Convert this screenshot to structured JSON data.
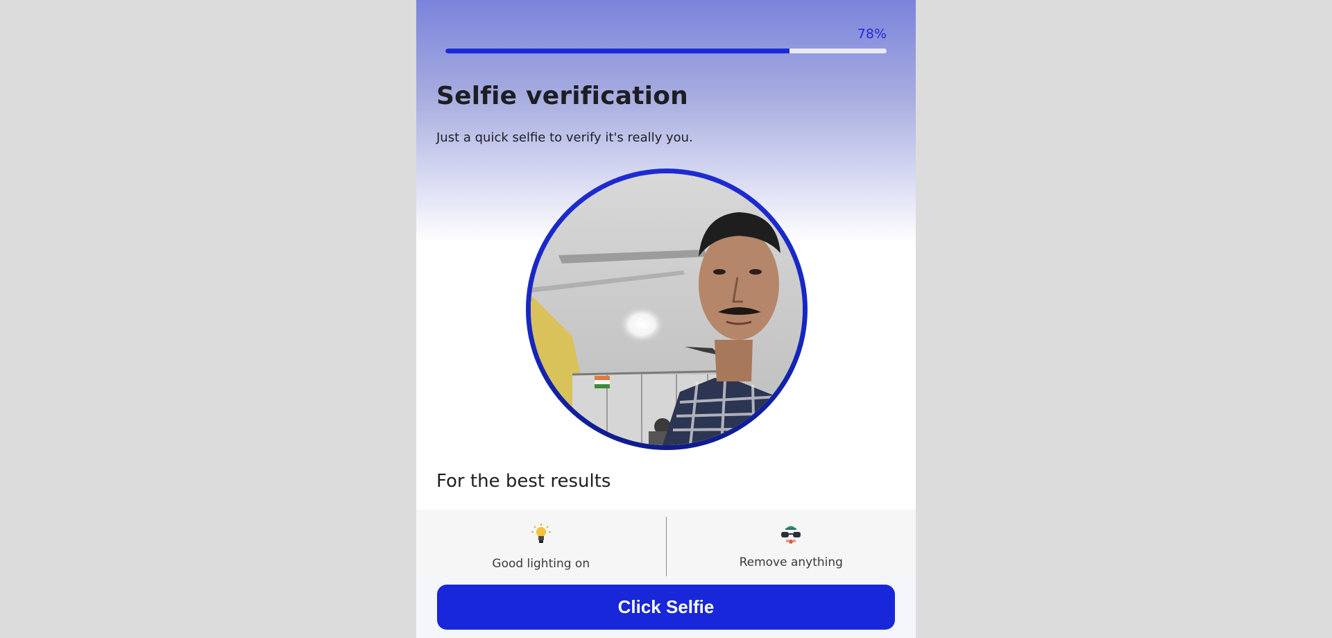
{
  "progress": {
    "label": "78%",
    "fraction": 0.78
  },
  "header": {
    "title": "Selfie verification",
    "subtitle": "Just a quick selfie to verify it's really you."
  },
  "camera": {
    "icon": "camera-preview"
  },
  "tips": {
    "heading": "For the best results",
    "items": [
      {
        "icon": "lightbulb-icon",
        "text": "Good lighting on"
      },
      {
        "icon": "accessories-icon",
        "text": "Remove anything"
      }
    ]
  },
  "action": {
    "button_label": "Click Selfie"
  },
  "colors": {
    "accent": "#1727d9",
    "page_background": "#dcdcdc"
  }
}
